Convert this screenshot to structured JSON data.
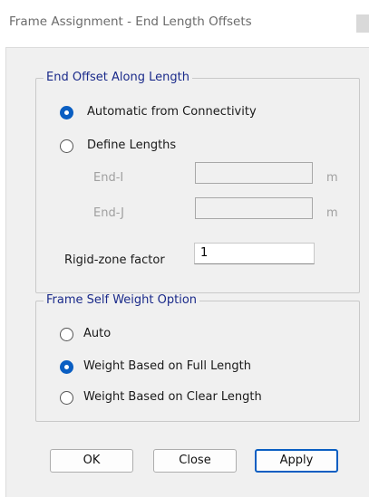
{
  "window": {
    "title": "Frame Assignment - End Length Offsets"
  },
  "end_offset_group": {
    "title": "End Offset Along Length",
    "option_automatic": "Automatic from Connectivity",
    "option_define": "Define Lengths",
    "selected": "automatic",
    "end_i_label": "End-I",
    "end_i_value": "",
    "end_i_unit": "m",
    "end_j_label": "End-J",
    "end_j_value": "",
    "end_j_unit": "m",
    "rigid_zone_label": "Rigid-zone factor",
    "rigid_zone_value": "1"
  },
  "self_weight_group": {
    "title": "Frame Self Weight Option",
    "option_auto": "Auto",
    "option_full": "Weight Based on Full Length",
    "option_clear": "Weight Based on Clear Length",
    "selected": "full"
  },
  "buttons": {
    "ok": "OK",
    "close": "Close",
    "apply": "Apply"
  },
  "colors": {
    "accent": "#0a5ec2",
    "group_title": "#1a2a8a",
    "dialog_bg": "#f0f0f0"
  }
}
